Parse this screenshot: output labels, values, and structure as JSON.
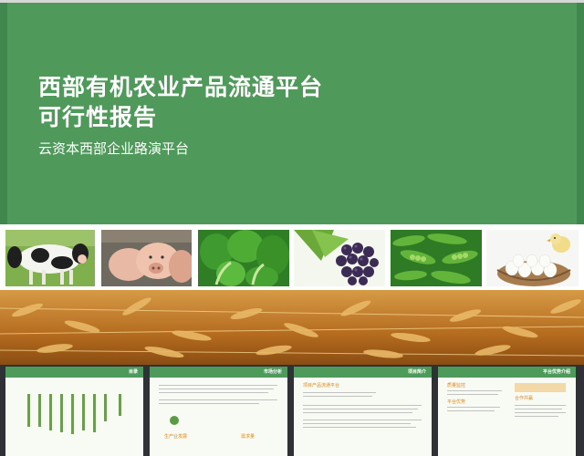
{
  "slide": {
    "title_line1": "西部有机农业产品流通平台",
    "title_line2": "可行性报告",
    "subtitle": "云资本西部企业路演平台"
  },
  "photos": [
    {
      "name": "cow-photo",
      "depicts": "cow"
    },
    {
      "name": "pig-photo",
      "depicts": "pig"
    },
    {
      "name": "bokchoy-photo",
      "depicts": "bok choy"
    },
    {
      "name": "grape-photo",
      "depicts": "grapes"
    },
    {
      "name": "peas-photo",
      "depicts": "green peas"
    },
    {
      "name": "eggs-photo",
      "depicts": "eggs and chick"
    }
  ],
  "thumbnails": [
    {
      "header": "目录"
    },
    {
      "header": "市场分析",
      "labels": [
        "生产业发展",
        "需求量"
      ]
    },
    {
      "header": "项目简介",
      "labels": [
        "项目产品流通平台"
      ]
    },
    {
      "header": "平台优势介绍",
      "labels": [
        "质量监控",
        "平台优势",
        "合作共赢"
      ]
    }
  ],
  "colors": {
    "hero_green": "#4f9a5b",
    "header_green": "#4d9a5a",
    "accent_orange": "#d98a1e"
  }
}
